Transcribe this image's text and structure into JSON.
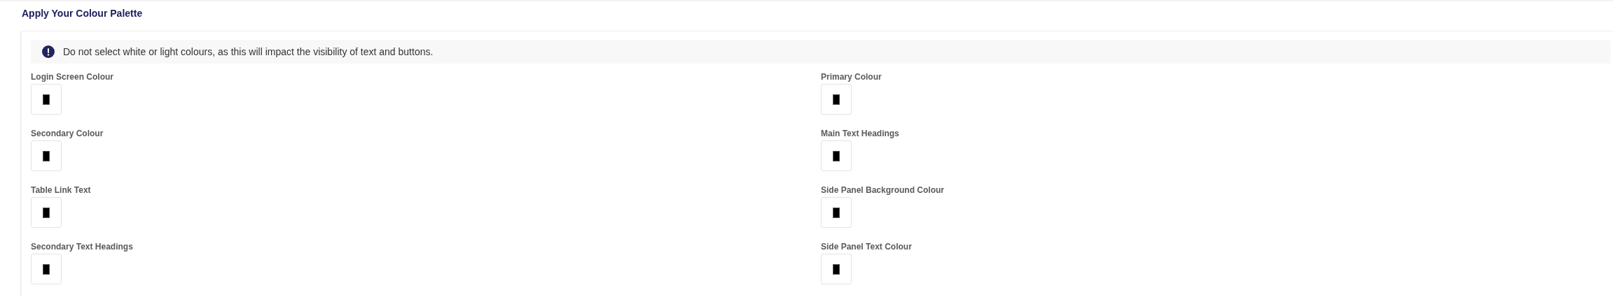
{
  "title": "Apply Your Colour Palette",
  "alert": {
    "text": "Do not select white or light colours, as this will impact the visibility of text and buttons."
  },
  "fields": [
    {
      "label": "Login Screen Colour",
      "color": "#000000"
    },
    {
      "label": "Primary Colour",
      "color": "#000000"
    },
    {
      "label": "Secondary Colour",
      "color": "#000000"
    },
    {
      "label": "Main Text Headings",
      "color": "#000000"
    },
    {
      "label": "Table Link Text",
      "color": "#000000"
    },
    {
      "label": "Side Panel Background Colour",
      "color": "#000000"
    },
    {
      "label": "Secondary Text Headings",
      "color": "#000000"
    },
    {
      "label": "Side Panel Text Colour",
      "color": "#000000"
    }
  ]
}
